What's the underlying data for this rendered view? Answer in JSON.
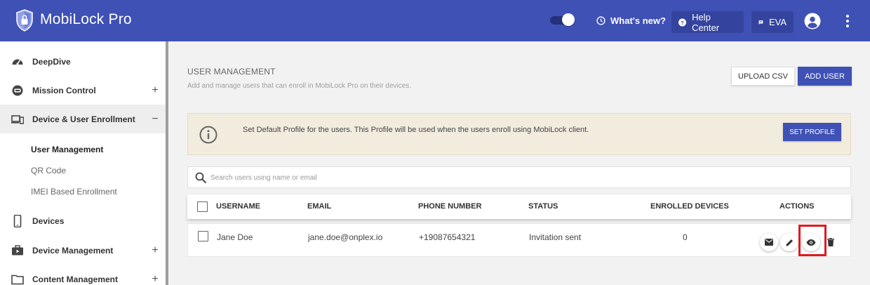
{
  "header": {
    "app_title": "MobiLock Pro",
    "whats_new": "What's new?",
    "help_center": "Help Center",
    "eva": "EVA",
    "bg_color": "#3f51b5"
  },
  "sidebar": {
    "items": [
      {
        "label": "DeepDive",
        "icon": "speedometer-icon"
      },
      {
        "label": "Mission Control",
        "icon": "mission-control-icon",
        "toggle": "+"
      },
      {
        "label": "Device & User Enrollment",
        "icon": "devices-icon",
        "toggle": "−"
      },
      {
        "label": "Devices",
        "icon": "phone-icon"
      },
      {
        "label": "Device Management",
        "icon": "briefcase-icon",
        "toggle": "+"
      },
      {
        "label": "Content Management",
        "icon": "folder-icon",
        "toggle": "+"
      }
    ],
    "sub_items": [
      "User Management",
      "QR Code",
      "IMEI Based Enrollment"
    ]
  },
  "main": {
    "title": "USER MANAGEMENT",
    "subtitle": "Add and manage users that can enroll in MobiLock Pro on their devices.",
    "upload_csv": "UPLOAD CSV",
    "add_user": "ADD USER",
    "banner_text": "Set Default Profile for the users. This Profile will be used when the users enroll using MobiLock client.",
    "set_profile": "SET PROFILE",
    "search_placeholder": "Search users using name or email"
  },
  "table": {
    "columns": [
      "USERNAME",
      "EMAIL",
      "PHONE NUMBER",
      "STATUS",
      "ENROLLED DEVICES",
      "ACTIONS"
    ],
    "rows": [
      {
        "username": "Jane Doe",
        "email": "jane.doe@onplex.io",
        "phone": "+19087654321",
        "status": "Invitation sent",
        "enrolled": "0"
      }
    ]
  },
  "colors": {
    "accent": "#3f51b5",
    "highlight": "#e0191e",
    "banner": "#f2ecdf"
  }
}
